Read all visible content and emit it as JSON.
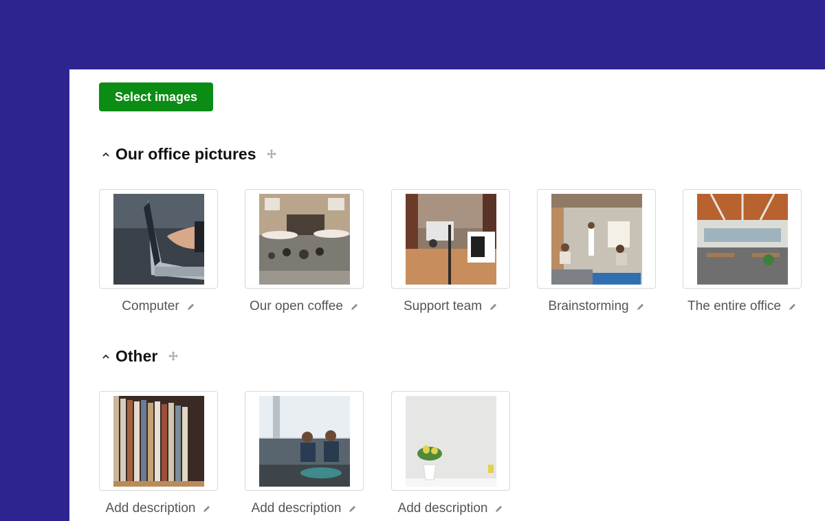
{
  "toolbar": {
    "select_label": "Select images"
  },
  "groups": [
    {
      "title": "Our office pictures",
      "images": [
        {
          "caption": "Computer",
          "thumb": "laptop-photo"
        },
        {
          "caption": "Our open coffee",
          "thumb": "cafe-terrace-photo"
        },
        {
          "caption": "Support team",
          "thumb": "open-office-photo"
        },
        {
          "caption": "Brainstorming",
          "thumb": "meeting-photo"
        },
        {
          "caption": "The entire office",
          "thumb": "office-hall-photo"
        }
      ]
    },
    {
      "title": "Other",
      "images": [
        {
          "caption": "Add description",
          "thumb": "records-shelf-photo"
        },
        {
          "caption": "Add description",
          "thumb": "sofa-meeting-photo"
        },
        {
          "caption": "Add description",
          "thumb": "plant-pot-photo"
        }
      ]
    }
  ],
  "icons": {
    "collapse": "chevron-up-icon",
    "drag": "move-icon",
    "edit": "pencil-icon"
  },
  "colors": {
    "background": "#2d2490",
    "button": "#0b8c14",
    "panel": "#ffffff"
  }
}
